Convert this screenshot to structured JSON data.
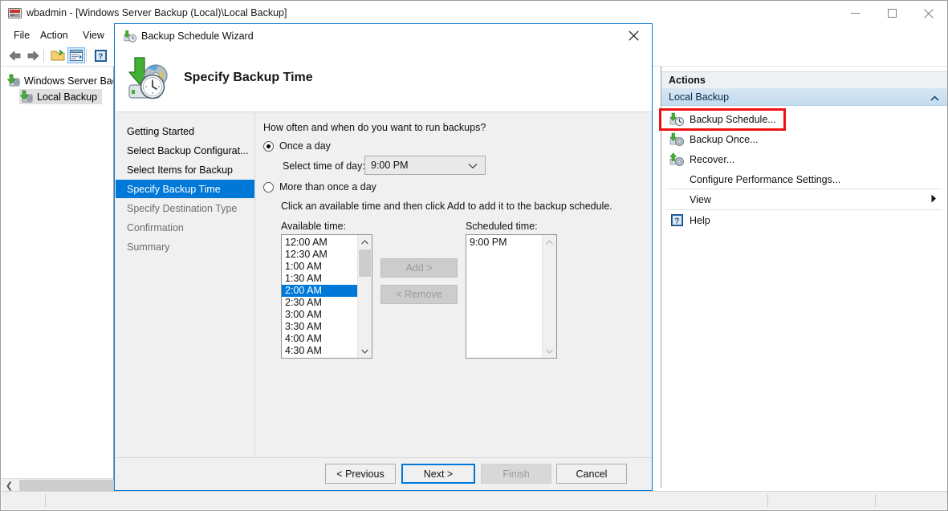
{
  "window": {
    "title": "wbadmin - [Windows Server Backup (Local)\\Local Backup]",
    "icon": "wbadmin-icon",
    "minimize_label": "Minimize",
    "maximize_label": "Maximize",
    "close_label": "Close"
  },
  "menu": {
    "items": [
      "File",
      "Action",
      "View"
    ]
  },
  "toolbar": {
    "items": [
      {
        "name": "back-icon",
        "label": "Back"
      },
      {
        "name": "forward-icon",
        "label": "Forward"
      },
      {
        "name": "show-hide-console-tree-icon",
        "label": "Show/Hide Console Tree"
      },
      {
        "name": "properties-icon",
        "label": "Properties"
      },
      {
        "name": "help-icon",
        "label": "Help"
      }
    ]
  },
  "tree": {
    "items": [
      {
        "label": "Windows Server Back",
        "icon": "server-backup-icon",
        "selected": false
      },
      {
        "label": "Local Backup",
        "icon": "local-backup-icon",
        "selected": true
      }
    ],
    "scroll_left_label": "Scroll left"
  },
  "actions": {
    "header": "Actions",
    "group": "Local Backup",
    "collapse_label": "Collapse",
    "items": [
      {
        "label": "Backup Schedule...",
        "icon": "backup-schedule-icon",
        "highlighted": true
      },
      {
        "label": "Backup Once...",
        "icon": "backup-once-icon",
        "highlighted": false
      },
      {
        "label": "Recover...",
        "icon": "recover-icon",
        "highlighted": false
      },
      {
        "label": "Configure Performance Settings...",
        "icon": "none",
        "highlighted": false
      },
      {
        "label": "View",
        "icon": "none",
        "submenu": true,
        "highlighted": false
      },
      {
        "label": "Help",
        "icon": "help-icon",
        "highlighted": false
      }
    ]
  },
  "dialog": {
    "title": "Backup Schedule Wizard",
    "title_icon": "backup-schedule-icon",
    "close_label": "Close",
    "heading": "Specify Backup Time",
    "heading_icon": "backup-time-icon",
    "nav": [
      {
        "label": "Getting Started",
        "state": "done"
      },
      {
        "label": "Select Backup Configurat...",
        "state": "done"
      },
      {
        "label": "Select Items for Backup",
        "state": "done"
      },
      {
        "label": "Specify Backup Time",
        "state": "current"
      },
      {
        "label": "Specify Destination Type",
        "state": "todo"
      },
      {
        "label": "Confirmation",
        "state": "todo"
      },
      {
        "label": "Summary",
        "state": "todo"
      }
    ],
    "question": "How often and when do you want to run backups?",
    "once_a_day": {
      "label": "Once a day",
      "selected": true,
      "time_label": "Select time of day:",
      "time_value": "9:00 PM",
      "chevron": "chevron-down-icon"
    },
    "more_than_once": {
      "label": "More than once a day",
      "selected": false,
      "hint": "Click an available time and then click Add to add it to the backup schedule.",
      "available_label": "Available time:",
      "scheduled_label": "Scheduled time:",
      "available_times": [
        "12:00 AM",
        "12:30 AM",
        "1:00 AM",
        "1:30 AM",
        "2:00 AM",
        "2:30 AM",
        "3:00 AM",
        "3:30 AM",
        "4:00 AM",
        "4:30 AM"
      ],
      "available_selected": "2:00 AM",
      "scheduled_times": [
        "9:00 PM"
      ],
      "add_label": "Add >",
      "remove_label": "< Remove",
      "add_enabled": false,
      "remove_enabled": false
    },
    "buttons": [
      {
        "label": "< Previous",
        "state": "normal"
      },
      {
        "label": "Next >",
        "state": "focus"
      },
      {
        "label": "Finish",
        "state": "disabled"
      },
      {
        "label": "Cancel",
        "state": "normal"
      }
    ]
  },
  "colors": {
    "accent": "#0078d7",
    "annotation": "#ef1111",
    "selection": "#0078d7",
    "group_header": "#c3dcf0"
  }
}
